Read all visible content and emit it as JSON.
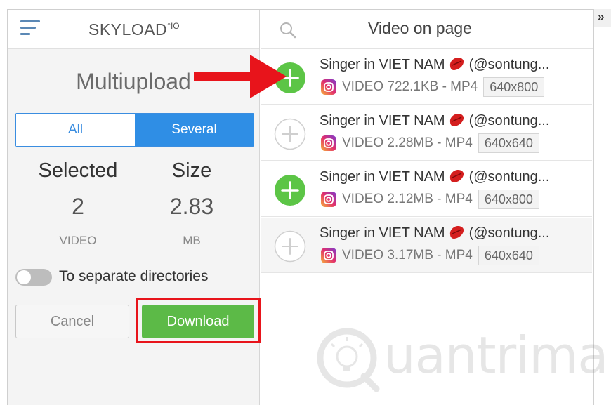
{
  "left_panel": {
    "brand": "SKYLOAD",
    "brand_suffix": "°IO",
    "title": "Multiupload",
    "mode_toggle": {
      "all_label": "All",
      "several_label": "Several",
      "selected": "Several"
    },
    "stats": {
      "selected": {
        "label": "Selected",
        "value": "2",
        "unit": "VIDEO"
      },
      "size": {
        "label": "Size",
        "value": "2.83",
        "unit": "MB"
      }
    },
    "separate_dirs": {
      "label": "To separate directories",
      "enabled": false
    },
    "cancel_label": "Cancel",
    "download_label": "Download"
  },
  "right_panel": {
    "header_title": "Video on page",
    "items": [
      {
        "title_a": "Singer in VIET NAM",
        "title_b": "(@sontung...",
        "meta": "VIDEO 722.1KB - MP4",
        "resolution": "640x800",
        "selected": true
      },
      {
        "title_a": "Singer in VIET NAM",
        "title_b": "(@sontung...",
        "meta": "VIDEO 2.28MB - MP4",
        "resolution": "640x640",
        "selected": false
      },
      {
        "title_a": "Singer in VIET NAM",
        "title_b": "(@sontung...",
        "meta": "VIDEO 2.12MB - MP4",
        "resolution": "640x800",
        "selected": true
      },
      {
        "title_a": "Singer in VIET NAM",
        "title_b": "(@sontung...",
        "meta": "VIDEO 3.17MB - MP4",
        "resolution": "640x640",
        "selected": false
      }
    ]
  },
  "strip": {
    "chevron": "»"
  },
  "watermark": {
    "text": "uantrimang"
  },
  "colors": {
    "accent_blue": "#2f8ee5",
    "download_green": "#5cba47",
    "highlight_red": "#e8141b",
    "add_green": "#5cc546"
  },
  "icons": [
    "menu-icon",
    "search-icon",
    "add-circle-icon",
    "instagram-icon",
    "kiss-lips-icon",
    "double-chevron-icon"
  ]
}
